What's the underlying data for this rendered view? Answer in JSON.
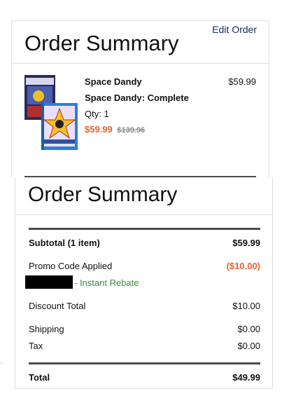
{
  "top_summary": {
    "title": "Order Summary",
    "edit_label": "Edit Order",
    "product": {
      "name": "Space Dandy",
      "full_name": "Space Dandy: Complete",
      "qty_label": "Qty: 1",
      "sale_price": "$59.99",
      "list_price": "$139.96",
      "line_price": "$59.99",
      "image_icon": "product-box-art"
    }
  },
  "summary": {
    "title": "Order Summary",
    "subtotal_label": "Subtotal (1 item)",
    "subtotal_value": "$59.99",
    "promo_label": "Promo Code Applied",
    "promo_value": "($10.00)",
    "rebate_text": "- Instant Rebate",
    "discount_label": "Discount Total",
    "discount_value": "$10.00",
    "shipping_label": "Shipping",
    "shipping_value": "$0.00",
    "tax_label": "Tax",
    "tax_value": "$0.00",
    "total_label": "Total",
    "total_value": "$49.99"
  },
  "colors": {
    "accent_orange": "#e7622a",
    "rebate_green": "#3e8e3e",
    "link_navy": "#1b2a64",
    "divider_dark": "#4b4b4b"
  }
}
